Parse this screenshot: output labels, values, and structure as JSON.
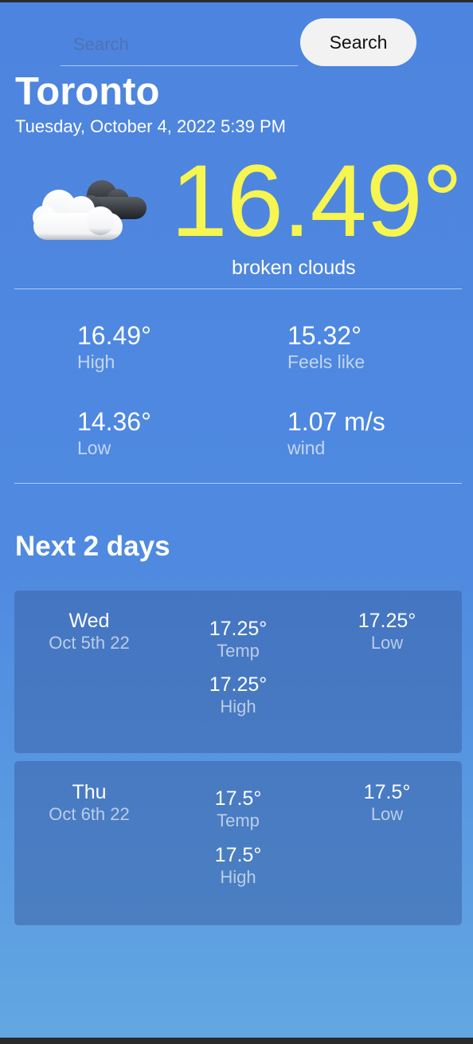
{
  "search": {
    "placeholder": "Search",
    "button_label": "Search"
  },
  "current": {
    "city": "Toronto",
    "datetime": "Tuesday, October 4, 2022 5:39 PM",
    "icon": "broken-clouds-icon",
    "temperature": "16.49°",
    "description": "broken clouds",
    "stats": {
      "high": {
        "value": "16.49°",
        "label": "High"
      },
      "feels_like": {
        "value": "15.32°",
        "label": "Feels like"
      },
      "low": {
        "value": "14.36°",
        "label": "Low"
      },
      "wind": {
        "value": "1.07 m/s",
        "label": "wind"
      }
    }
  },
  "forecast": {
    "title": "Next 2 days",
    "days": [
      {
        "day": "Wed",
        "date": "Oct 5th 22",
        "temp": "17.25°",
        "temp_label": "Temp",
        "high": "17.25°",
        "high_label": "High",
        "low": "17.25°",
        "low_label": "Low"
      },
      {
        "day": "Thu",
        "date": "Oct 6th 22",
        "temp": "17.5°",
        "temp_label": "Temp",
        "high": "17.5°",
        "high_label": "High",
        "low": "17.5°",
        "low_label": "Low"
      }
    ]
  },
  "colors": {
    "background_top": "#4d84df",
    "background_bottom": "#62a7e2",
    "temperature_accent": "#f7f54f",
    "card_background": "#3c64aa"
  }
}
